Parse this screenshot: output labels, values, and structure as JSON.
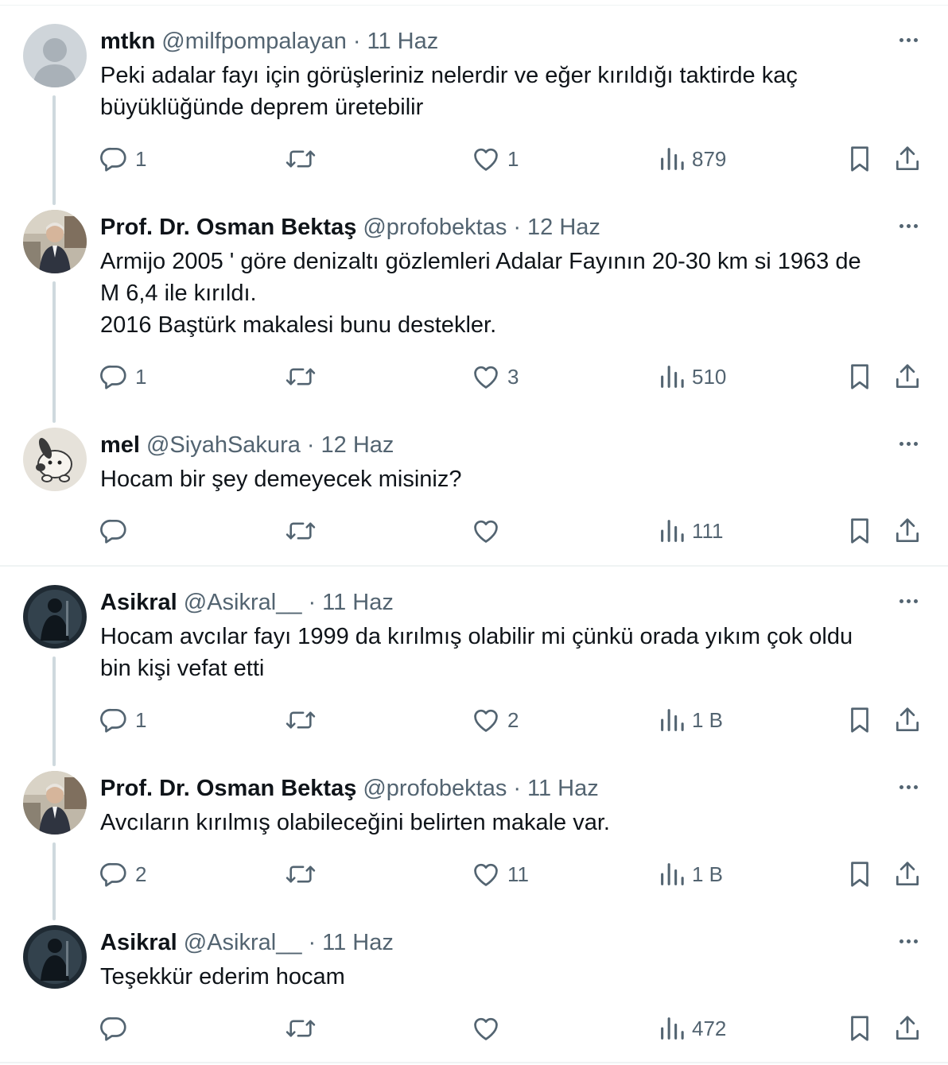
{
  "tweets": [
    {
      "name": "mtkn",
      "handle": "@milfpompalayan",
      "sep": "·",
      "date": "11 Haz",
      "lines": [
        "Peki adalar fayı için görüşleriniz nelerdir ve eğer kırıldığı taktirde kaç",
        "büyüklüğünde deprem üretebilir"
      ],
      "replies": "1",
      "retweets": "",
      "likes": "1",
      "views": "879",
      "avatar": "default"
    },
    {
      "name": "Prof. Dr. Osman Bektaş",
      "handle": "@profobektas",
      "sep": "·",
      "date": "12 Haz",
      "lines": [
        "Armijo 2005 ' göre denizaltı gözlemleri Adalar Fayının 20-30 km si 1963 de",
        "M 6,4 ile kırıldı.",
        "2016 Baştürk makalesi bunu destekler."
      ],
      "replies": "1",
      "retweets": "",
      "likes": "3",
      "views": "510",
      "avatar": "professor"
    },
    {
      "name": "mel",
      "handle": "@SiyahSakura",
      "sep": "·",
      "date": "12 Haz",
      "lines": [
        "Hocam bir şey demeyecek misiniz?"
      ],
      "replies": "",
      "retweets": "",
      "likes": "",
      "views": "111",
      "avatar": "bunny"
    },
    {
      "name": "Asikral",
      "handle": "@Asikral__",
      "sep": "·",
      "date": "11 Haz",
      "lines": [
        "Hocam avcılar fayı 1999 da kırılmış olabilir mi çünkü orada yıkım çok oldu",
        "bin kişi vefat etti"
      ],
      "replies": "1",
      "retweets": "",
      "likes": "2",
      "views": "1 B",
      "avatar": "dark"
    },
    {
      "name": "Prof. Dr. Osman Bektaş",
      "handle": "@profobektas",
      "sep": "·",
      "date": "11 Haz",
      "lines": [
        "Avcıların kırılmış olabileceğini belirten  makale var."
      ],
      "replies": "2",
      "retweets": "",
      "likes": "11",
      "views": "1 B",
      "avatar": "professor"
    },
    {
      "name": "Asikral",
      "handle": "@Asikral__",
      "sep": "·",
      "date": "11 Haz",
      "lines": [
        "Teşekkür ederim hocam"
      ],
      "replies": "",
      "retweets": "",
      "likes": "",
      "views": "472",
      "avatar": "dark"
    }
  ],
  "icons": {
    "reply": "speech-bubble",
    "retweet": "two-arrows-loop",
    "like": "heart-outline",
    "views": "bar-chart",
    "bookmark": "bookmark-outline",
    "share": "upload-arrow",
    "more": "three-dots"
  },
  "colors": {
    "text": "#0f1419",
    "muted": "#536471",
    "thread_line": "#cfd9de",
    "divider": "#eff3f4"
  }
}
